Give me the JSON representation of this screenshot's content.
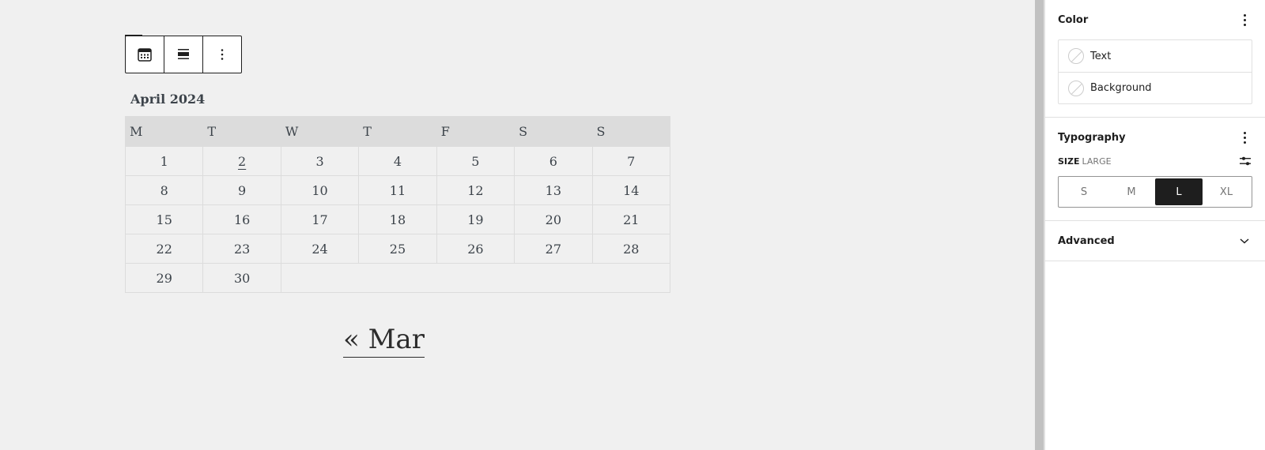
{
  "toolbar": {
    "buttons": [
      {
        "name": "calendar-block-button",
        "icon": "calendar-icon"
      },
      {
        "name": "align-button",
        "icon": "align-wide-icon"
      },
      {
        "name": "options-button",
        "icon": "more-vertical-icon"
      }
    ]
  },
  "calendar": {
    "caption": "April 2024",
    "weekdays": [
      "M",
      "T",
      "W",
      "T",
      "F",
      "S",
      "S"
    ],
    "weeks": [
      [
        "1",
        "2",
        "3",
        "4",
        "5",
        "6",
        "7"
      ],
      [
        "8",
        "9",
        "10",
        "11",
        "12",
        "13",
        "14"
      ],
      [
        "15",
        "16",
        "17",
        "18",
        "19",
        "20",
        "21"
      ],
      [
        "22",
        "23",
        "24",
        "25",
        "26",
        "27",
        "28"
      ],
      [
        "29",
        "30"
      ]
    ],
    "linked_day": "2",
    "prev_nav": "« Mar"
  },
  "sidebar": {
    "color": {
      "title": "Color",
      "items": [
        {
          "label": "Text"
        },
        {
          "label": "Background"
        }
      ]
    },
    "typography": {
      "title": "Typography",
      "size_label": "Size",
      "size_value": "Large",
      "options": [
        "S",
        "M",
        "L",
        "XL"
      ],
      "selected": "L"
    },
    "advanced": {
      "title": "Advanced"
    }
  },
  "colors": {
    "accent": "#1e1e1e",
    "canvas_bg": "#f0f0f0",
    "header_bg": "#dcdcdc",
    "text": "#3c434a"
  }
}
